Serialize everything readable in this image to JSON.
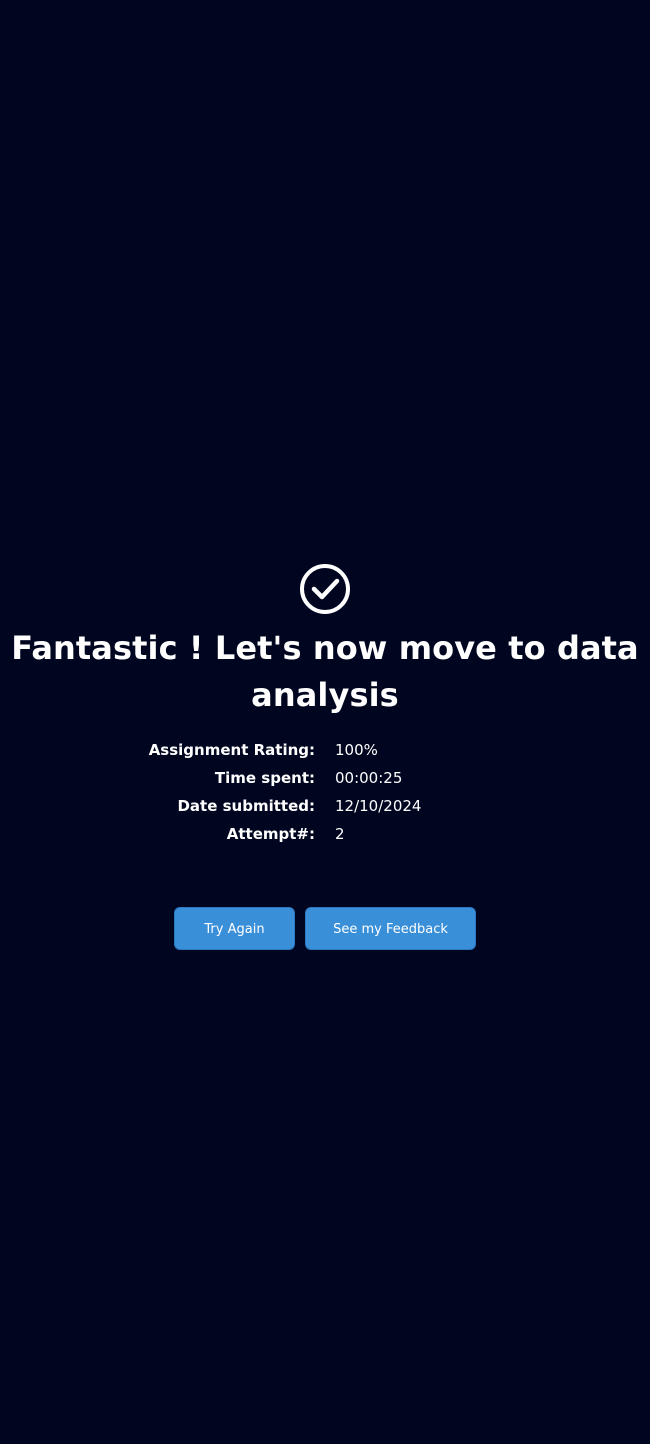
{
  "result": {
    "icon": "check-circle-icon",
    "title": "Fantastic ! Let's now move to data analysis",
    "stats": {
      "assignment_rating": {
        "label": "Assignment Rating:",
        "value": "100%"
      },
      "time_spent": {
        "label": "Time spent:",
        "value": "00:00:25"
      },
      "date_submitted": {
        "label": "Date submitted:",
        "value": "12/10/2024"
      },
      "attempt": {
        "label": "Attempt#:",
        "value": "2"
      }
    }
  },
  "actions": {
    "try_again_label": "Try Again",
    "see_feedback_label": "See my Feedback"
  },
  "colors": {
    "background": "#010620",
    "button": "#3a8fd9",
    "text": "#ffffff"
  }
}
